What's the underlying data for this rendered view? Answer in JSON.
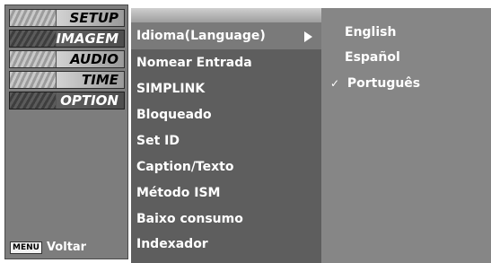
{
  "nav": {
    "items": [
      {
        "label": "SETUP",
        "active": false
      },
      {
        "label": "IMAGEM",
        "active": true
      },
      {
        "label": "AUDIO",
        "active": false
      },
      {
        "label": "TIME",
        "active": false
      },
      {
        "label": "OPTION",
        "active": true
      }
    ],
    "back_key": "MENU",
    "back_label": "Voltar"
  },
  "menu": {
    "items": [
      {
        "label": "Idioma(Language)",
        "selected": true,
        "has_submenu": true
      },
      {
        "label": "Nomear Entrada"
      },
      {
        "label": "SIMPLINK"
      },
      {
        "label": "Bloqueado"
      },
      {
        "label": "Set ID"
      },
      {
        "label": "Caption/Texto"
      },
      {
        "label": "Método ISM"
      },
      {
        "label": "Baixo consumo"
      },
      {
        "label": "Indexador"
      }
    ]
  },
  "language_options": {
    "items": [
      {
        "label": "English",
        "checked": false
      },
      {
        "label": "Español",
        "checked": false
      },
      {
        "label": "Português",
        "checked": true
      }
    ],
    "check_glyph": "✓"
  }
}
